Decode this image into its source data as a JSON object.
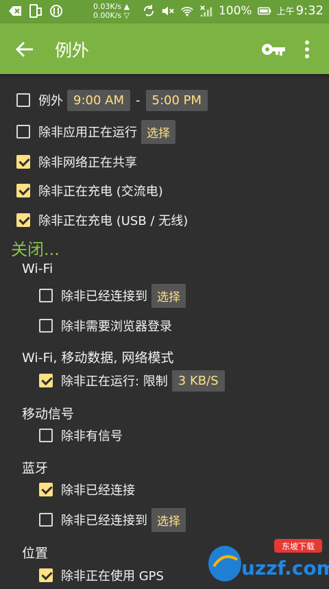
{
  "status_bar": {
    "speed_up": "0.03K/s ▲",
    "speed_down": "0.00K/s ▽",
    "battery": "100%",
    "time_prefix": "上午",
    "time": "9:32"
  },
  "app_bar": {
    "title": "例外"
  },
  "rows": {
    "exception": {
      "label": "例外",
      "start_time": "9:00 AM",
      "separator": "-",
      "end_time": "5:00 PM",
      "checked": false
    },
    "app_running": {
      "label": "除非应用正在运行",
      "chip": "选择",
      "checked": false
    },
    "tethering": {
      "label": "除非网络正在共享",
      "checked": true
    },
    "charging_ac": {
      "label": "除非正在充电 (交流电)",
      "checked": true
    },
    "charging_usb": {
      "label": "除非正在充电 (USB / 无线)",
      "checked": true
    }
  },
  "close_section": {
    "title": "关闭...",
    "wifi": {
      "title": "Wi-Fi",
      "connected": {
        "label": "除非已经连接到",
        "chip": "选择",
        "checked": false
      },
      "browser_login": {
        "label": "除非需要浏览器登录",
        "checked": false
      }
    },
    "data": {
      "title": "Wi-Fi, 移动数据, 网络模式",
      "running": {
        "label": "除非正在运行: 限制",
        "chip": "3 KB/S",
        "checked": true
      }
    },
    "signal": {
      "title": "移动信号",
      "has_signal": {
        "label": "除非有信号",
        "checked": false
      }
    },
    "bluetooth": {
      "title": "蓝牙",
      "connected": {
        "label": "除非已经连接",
        "checked": true
      },
      "connected_to": {
        "label": "除非已经连接到",
        "chip": "选择",
        "checked": false
      }
    },
    "location": {
      "title": "位置",
      "gps": {
        "label": "除非正在使用 GPS",
        "checked": true
      }
    }
  },
  "watermark": {
    "text": "uzzf.com",
    "tag": "东坡下载"
  },
  "colors": {
    "status_bar": "#689f38",
    "app_bar": "#7cb342",
    "background": "#2f2f2f",
    "accent": "#ffe082",
    "section": "#8bc34a"
  }
}
